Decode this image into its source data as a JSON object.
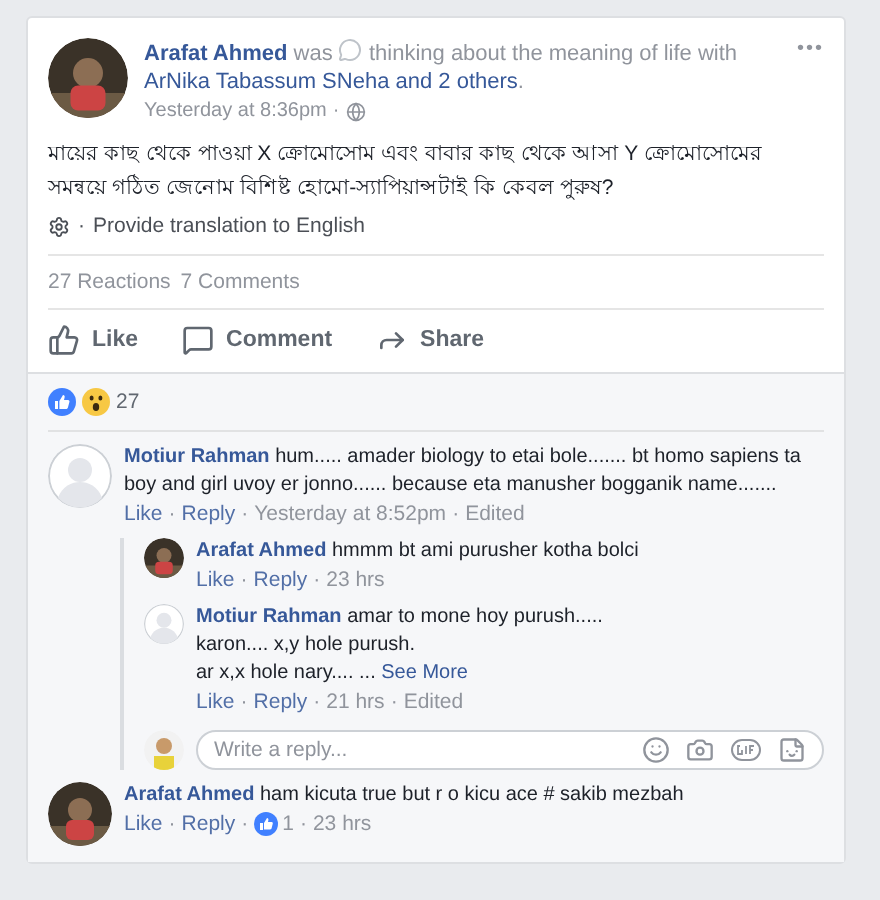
{
  "post": {
    "author": "Arafat Ahmed",
    "verb": "was",
    "activity": "thinking about the meaning of life with",
    "tagged": "ArNika Tabassum SNeha",
    "joiner": "and",
    "others": "2 others",
    "end": ".",
    "time": "Yesterday at 8:36pm",
    "menu": "•••",
    "text": "মায়ের কাছ থেকে পাওয়া X ক্রোমোসোম এবং বাবার কাছ থেকে আসা Y ক্রোমোসোমের সমন্বয়ে গঠিত জেনোম বিশিষ্ট হোমো-স্যাপিয়ান্সটাই কি কেবল পুরুষ?",
    "translate": "Provide translation to English",
    "reactions": "27 Reactions",
    "comments_count": "7 Comments",
    "actions": [
      {
        "kind": "like",
        "label": "Like"
      },
      {
        "kind": "comment",
        "label": "Comment"
      },
      {
        "kind": "share",
        "label": "Share"
      }
    ],
    "reaction_count": "27"
  },
  "separator": "·",
  "comments": [
    {
      "author": "Motiur Rahman",
      "avatar": {
        "kind": "blank"
      },
      "lines": [
        "hum..... amader biology to etai bole....... bt homo sapiens ta boy and girl uvoy er jonno...... because eta manusher bogganik name......."
      ],
      "links": [
        "Like",
        "Reply"
      ],
      "time": "Yesterday at 8:52pm",
      "edited": "Edited",
      "replies": [
        {
          "author": "Arafat Ahmed",
          "avatar": {
            "kind": "photo"
          },
          "lines": [
            "hmmm bt ami purusher kotha bolci"
          ],
          "links": [
            "Like",
            "Reply"
          ],
          "time": "23 hrs"
        },
        {
          "author": "Motiur Rahman",
          "avatar": {
            "kind": "blank"
          },
          "lines": [
            "amar to mone hoy purush.....",
            "karon.... x,y hole purush.",
            "ar x,x hole nary.... ..."
          ],
          "see_more": "See More",
          "links": [
            "Like",
            "Reply"
          ],
          "time": "21 hrs",
          "edited": "Edited"
        }
      ],
      "reply_box": {
        "placeholder": "Write a reply..."
      }
    },
    {
      "author": "Arafat Ahmed",
      "avatar": {
        "kind": "photo"
      },
      "lines": [
        "ham kicuta true but r o kicu ace # sakib mezbah"
      ],
      "links": [
        "Like",
        "Reply"
      ],
      "likes": "1",
      "time": "23 hrs"
    }
  ]
}
